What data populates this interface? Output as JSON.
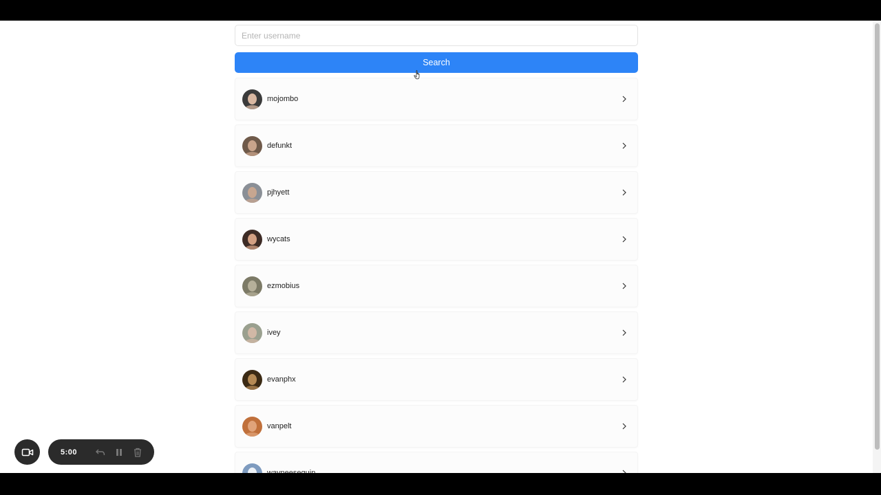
{
  "search": {
    "placeholder": "Enter username",
    "value": "",
    "button_label": "Search"
  },
  "users": [
    {
      "login": "mojombo",
      "avatar_colors": [
        "#3b3b3b",
        "#d9b8a2"
      ]
    },
    {
      "login": "defunkt",
      "avatar_colors": [
        "#6f5a4a",
        "#c9a48b"
      ]
    },
    {
      "login": "pjhyett",
      "avatar_colors": [
        "#8a8f96",
        "#c7a690"
      ]
    },
    {
      "login": "wycats",
      "avatar_colors": [
        "#3d2b25",
        "#d3a083"
      ]
    },
    {
      "login": "ezmobius",
      "avatar_colors": [
        "#7c7a66",
        "#b6b09a"
      ]
    },
    {
      "login": "ivey",
      "avatar_colors": [
        "#9aa08f",
        "#d1b8a6"
      ]
    },
    {
      "login": "evanphx",
      "avatar_colors": [
        "#3b2a14",
        "#b58a55"
      ]
    },
    {
      "login": "vanpelt",
      "avatar_colors": [
        "#c0703b",
        "#e0a37a"
      ]
    },
    {
      "login": "wayneeseguin",
      "avatar_colors": [
        "#7e9bbf",
        "#eef2f7"
      ]
    }
  ],
  "recorder": {
    "timer": "5:00",
    "icons": [
      "video-camera-icon",
      "undo-icon",
      "pause-icon",
      "trash-icon"
    ]
  },
  "colors": {
    "accent": "#2d84f7",
    "chrome": "#000000"
  }
}
